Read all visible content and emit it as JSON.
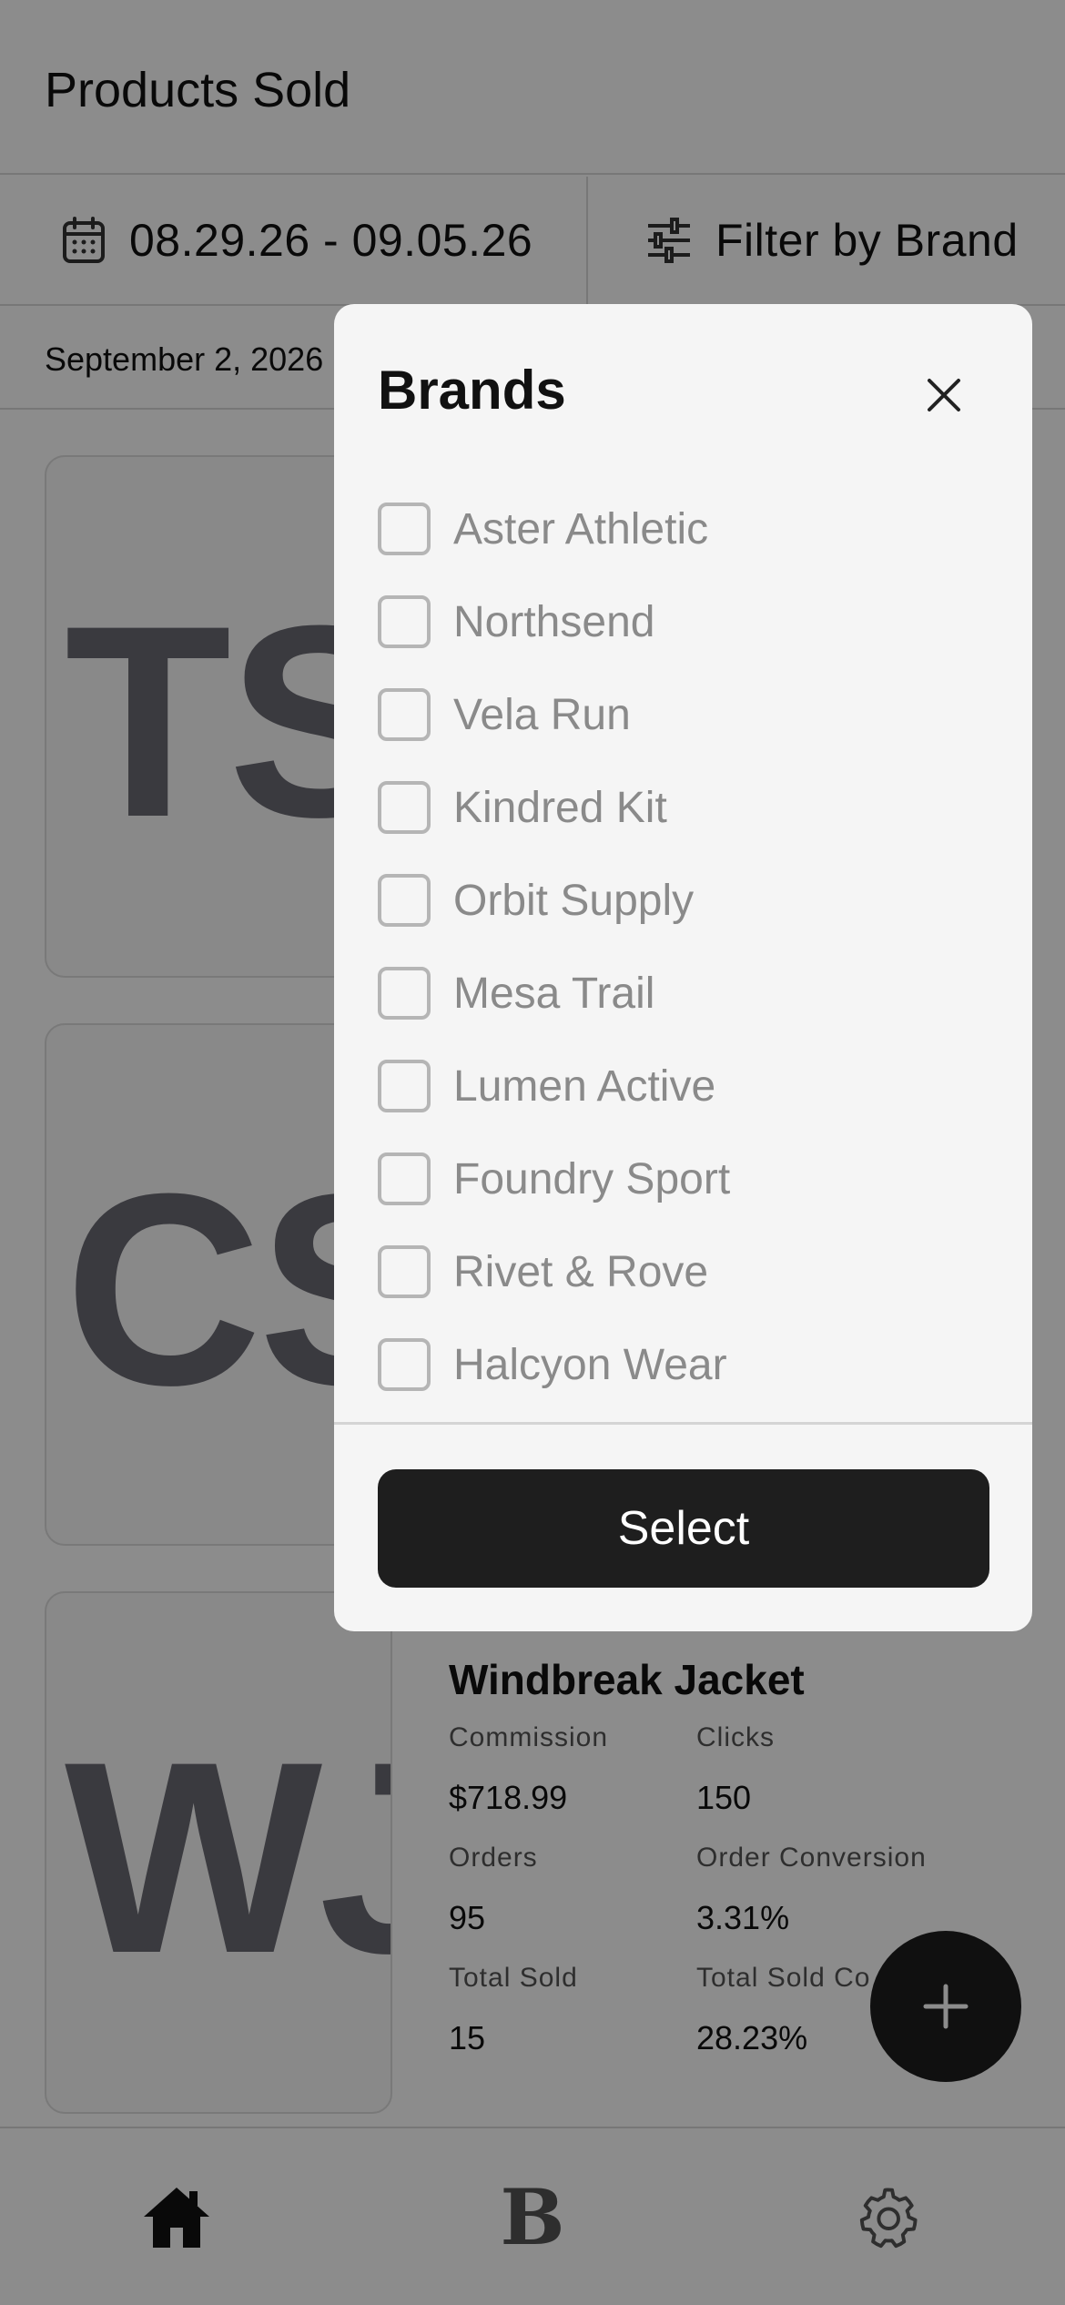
{
  "header": {
    "title": "Products Sold"
  },
  "filters": {
    "date_range": "08.29.26 - 09.05.26",
    "brand_filter": "Filter by Brand"
  },
  "date_group": "September 2, 2026",
  "products": [
    {
      "initials": "TS"
    },
    {
      "initials": "CS"
    },
    {
      "initials": "WJ",
      "name": "Windbreak Jacket",
      "metrics": {
        "commission_label": "Commission",
        "commission_value": "$718.99",
        "clicks_label": "Clicks",
        "clicks_value": "150",
        "orders_label": "Orders",
        "orders_value": "95",
        "order_conversion_label": "Order Conversion",
        "order_conversion_value": "3.31%",
        "total_sold_label": "Total Sold",
        "total_sold_value": "15",
        "total_sold_conversion_label": "Total Sold Co",
        "total_sold_conversion_value": "28.23%"
      }
    }
  ],
  "bottom_nav": {
    "items": [
      {
        "icon": "home-icon"
      },
      {
        "label": "B"
      },
      {
        "icon": "gear-icon"
      }
    ]
  },
  "fab": {
    "icon": "plus-icon"
  },
  "modal": {
    "title": "Brands",
    "brands": [
      "Aster Athletic",
      "Northsend",
      "Vela Run",
      "Kindred Kit",
      "Orbit Supply",
      "Mesa Trail",
      "Lumen Active",
      "Foundry Sport",
      "Rivet & Rove",
      "Halcyon Wear"
    ],
    "select_label": "Select"
  },
  "colors": {
    "overlay": "#000000",
    "primary_button": "#1e1e1e",
    "modal_background": "#f5f5f5",
    "thumb_text": "#6b6a74"
  }
}
